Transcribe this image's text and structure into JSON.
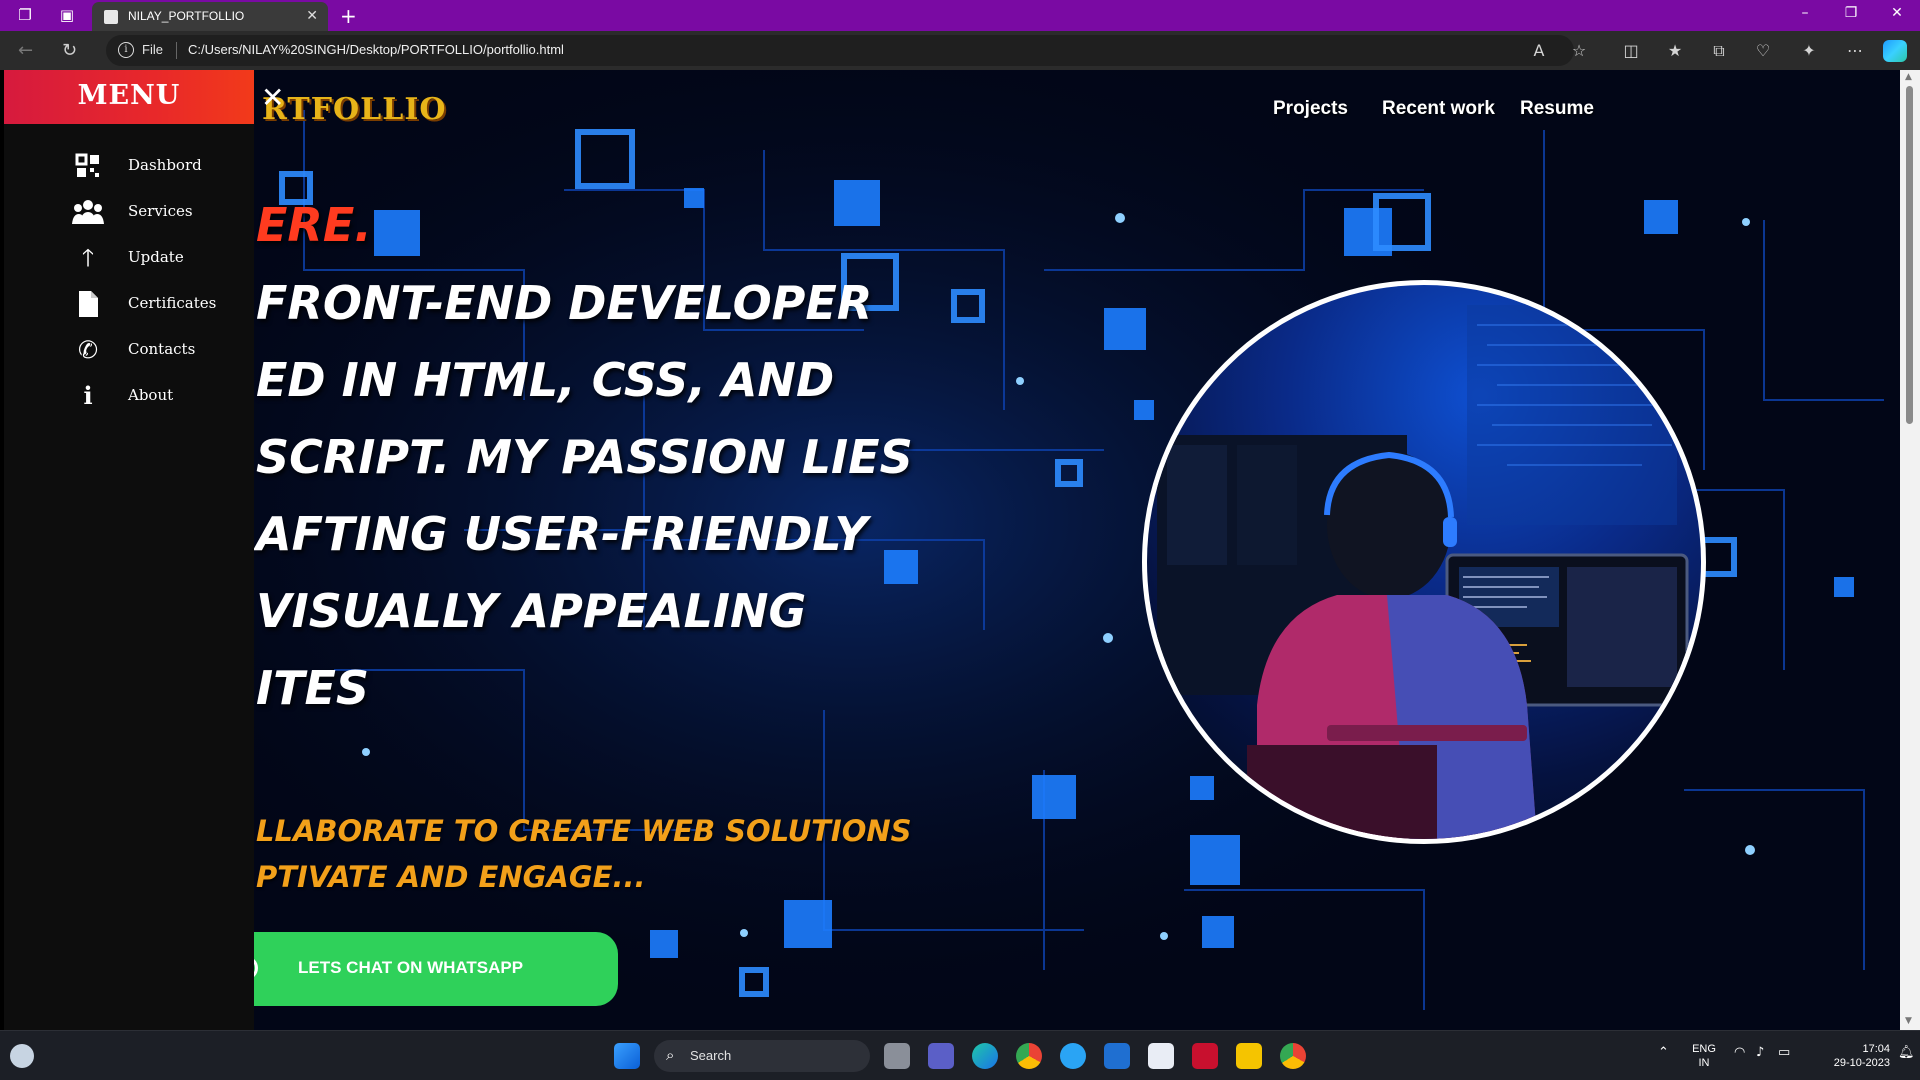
{
  "browser": {
    "tab_title": "NILAY_PORTFOLLIO",
    "scheme_label": "File",
    "url": "C:/Users/NILAY%20SINGH/Desktop/PORTFOLLIO/portfollio.html"
  },
  "site": {
    "logo": "RTFOLLIO",
    "nav": [
      "Projects",
      "Recent work",
      "Resume"
    ],
    "hero_lines": [
      "ERE.",
      "FRONT-END DEVELOPER",
      "ED IN HTML, CSS, AND",
      "SCRIPT. MY PASSION LIES",
      "AFTING USER-FRIENDLY",
      "VISUALLY APPEALING",
      "ITES"
    ],
    "sub_lines": [
      "LLABORATE TO CREATE WEB SOLUTIONS",
      "PTIVATE AND ENGAGE..."
    ],
    "cta": "LETS CHAT ON WHATSAPP"
  },
  "menu": {
    "title": "MENU",
    "close": "✕",
    "items": [
      {
        "label": "Dashbord",
        "icon": "grid-icon"
      },
      {
        "label": "Services",
        "icon": "users-icon"
      },
      {
        "label": "Update",
        "icon": "arrow-up-icon"
      },
      {
        "label": "Certificates",
        "icon": "document-icon"
      },
      {
        "label": "Contacts",
        "icon": "phone-icon"
      },
      {
        "label": "About",
        "icon": "info-icon"
      }
    ]
  },
  "taskbar": {
    "search_label": "Search",
    "lang_top": "ENG",
    "lang_bottom": "IN",
    "time": "17:04",
    "date": "29-10-2023"
  },
  "colors": {
    "tabbar": "#7a0aa3",
    "menu_header": "#e8282a",
    "whatsapp_button": "#2fd15a",
    "hero_accent": "#ff3b1f",
    "sub_text": "#f2a01a",
    "logo": "#e7b419"
  }
}
